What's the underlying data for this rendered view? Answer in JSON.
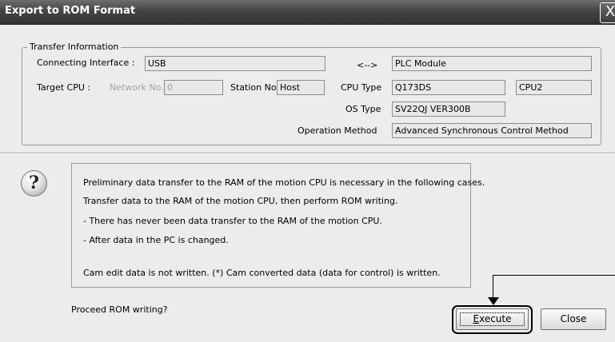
{
  "window": {
    "title": "Export to ROM Format",
    "close_glyph": "X"
  },
  "transfer_info": {
    "legend": "Transfer Information",
    "connecting_interface_label": "Connecting Interface :",
    "connecting_interface_value": "USB",
    "arrow": "<-->",
    "plc_module_value": "PLC Module",
    "target_cpu_label": "Target CPU :",
    "network_no_label": "Network No.",
    "network_no_value": "0",
    "station_no_label": "Station No.",
    "station_no_value": "Host",
    "cpu_type_label": "CPU Type",
    "cpu_type_value": "Q173DS",
    "cpu_slot_value": "CPU2",
    "os_type_label": "OS Type",
    "os_type_value": "SV22QJ VER300B",
    "operation_method_label": "Operation Method",
    "operation_method_value": "Advanced Synchronous Control Method"
  },
  "message": {
    "icon": "question-icon",
    "lines": [
      "Preliminary data transfer to the RAM of the motion CPU is necessary in the following cases.",
      "Transfer data to the RAM of the motion CPU, then perform ROM writing.",
      "- There has never been data transfer to the RAM of the motion CPU.",
      "- After data in the PC is changed.",
      "Cam edit data is not written.  (*) Cam converted data (data for control) is written."
    ]
  },
  "prompt": "Proceed ROM writing?",
  "buttons": {
    "execute_mnemonic": "E",
    "execute_rest": "xecute",
    "close_label": "Close"
  }
}
